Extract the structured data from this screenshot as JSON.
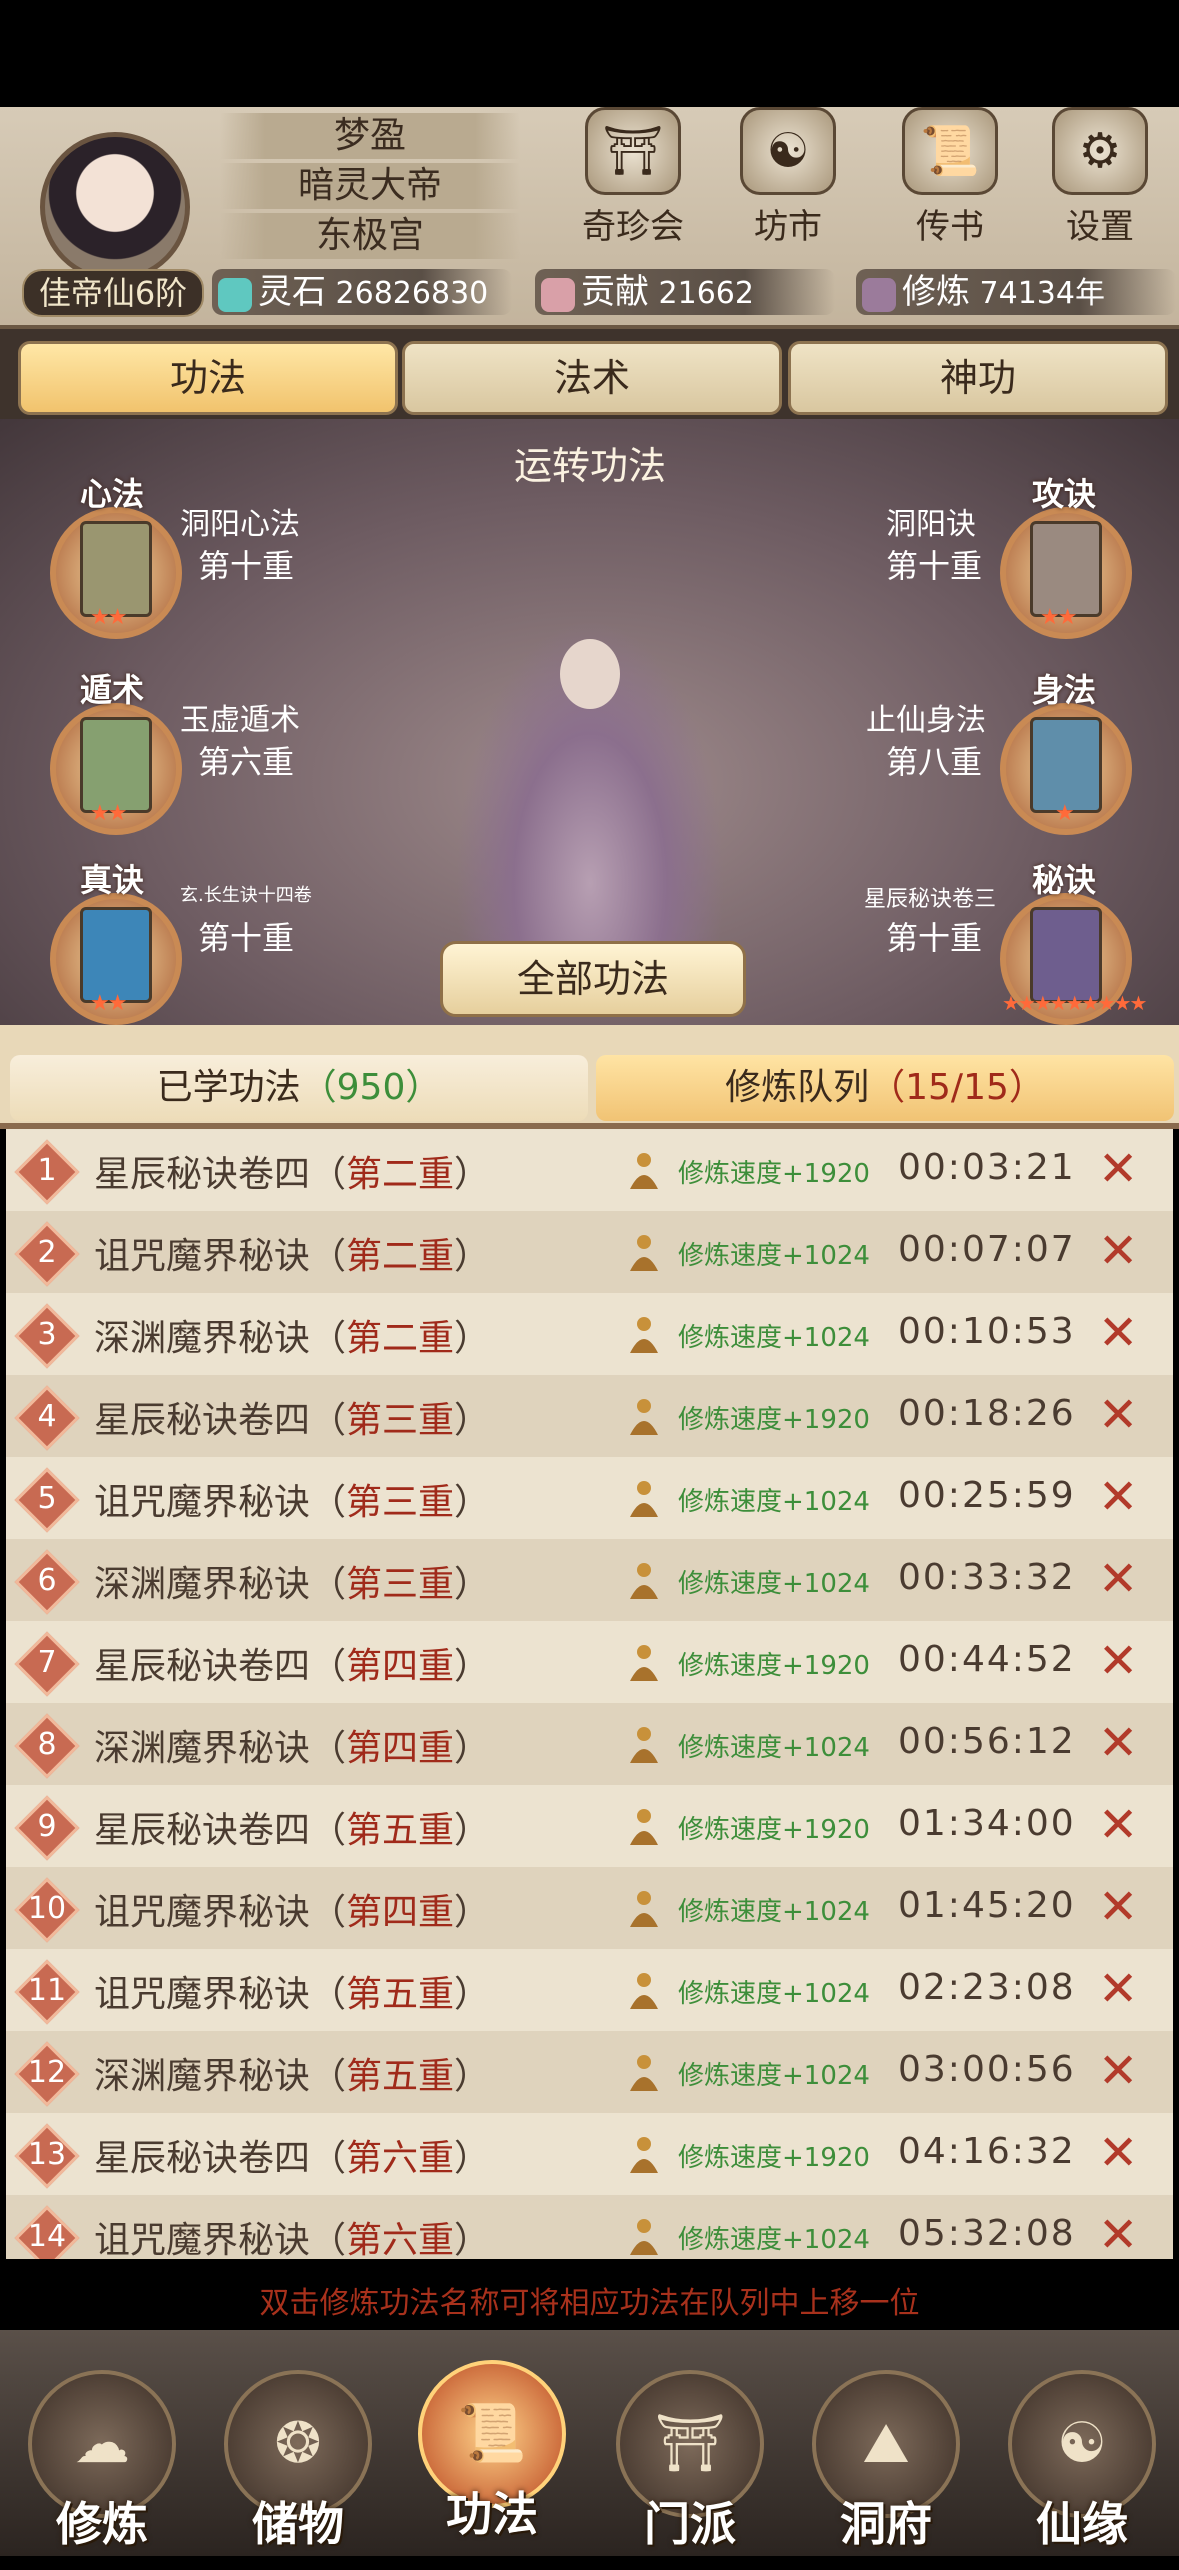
{
  "header": {
    "rank": "佳帝仙6阶",
    "names": [
      "梦盈",
      "暗灵大帝",
      "东极宫"
    ],
    "icons": [
      {
        "label": "奇珍会",
        "icon": "pavilion-icon"
      },
      {
        "label": "坊市",
        "icon": "market-icon"
      },
      {
        "label": "传书",
        "icon": "scroll-icon"
      },
      {
        "label": "设置",
        "icon": "gear-icon"
      }
    ],
    "resources": [
      {
        "label": "灵石",
        "value": "26826830",
        "icon": "spirit-stone-icon",
        "color": "#5fc8c0"
      },
      {
        "label": "贡献",
        "value": "21662",
        "icon": "contribution-icon",
        "color": "#d9a0a8"
      },
      {
        "label": "修炼",
        "value": "74134年",
        "icon": "cultivation-icon",
        "color": "#9b7b9b"
      }
    ]
  },
  "tabs": [
    {
      "label": "功法",
      "active": true
    },
    {
      "label": "法术",
      "active": false
    },
    {
      "label": "神功",
      "active": false
    }
  ],
  "scene": {
    "title": "运转功法",
    "slots": [
      {
        "type": "心法",
        "name": "洞阳心法",
        "level": "第十重",
        "stars": "★★"
      },
      {
        "type": "攻诀",
        "name": "洞阳诀",
        "level": "第十重",
        "stars": "★★"
      },
      {
        "type": "遁术",
        "name": "玉虚遁术",
        "level": "第六重",
        "stars": "★★"
      },
      {
        "type": "身法",
        "name": "止仙身法",
        "level": "第八重",
        "stars": "★"
      },
      {
        "type": "真诀",
        "name": "玄.长生诀十四卷",
        "level": "第十重",
        "stars": "★★"
      },
      {
        "type": "秘诀",
        "name": "星辰秘诀卷三",
        "level": "第十重",
        "stars": "★★★★★★★★★"
      }
    ],
    "all_button": "全部功法"
  },
  "list_tabs": {
    "learned_label": "已学功法",
    "learned_count": "（950）",
    "queue_label": "修炼队列",
    "queue_count": "（15/15）"
  },
  "queue": [
    {
      "num": "1",
      "name": "星辰秘诀卷四",
      "level": "第二重",
      "speed": "修炼速度+1920",
      "time": "00:03:21"
    },
    {
      "num": "2",
      "name": "诅咒魔界秘诀",
      "level": "第二重",
      "speed": "修炼速度+1024",
      "time": "00:07:07"
    },
    {
      "num": "3",
      "name": "深渊魔界秘诀",
      "level": "第二重",
      "speed": "修炼速度+1024",
      "time": "00:10:53"
    },
    {
      "num": "4",
      "name": "星辰秘诀卷四",
      "level": "第三重",
      "speed": "修炼速度+1920",
      "time": "00:18:26"
    },
    {
      "num": "5",
      "name": "诅咒魔界秘诀",
      "level": "第三重",
      "speed": "修炼速度+1024",
      "time": "00:25:59"
    },
    {
      "num": "6",
      "name": "深渊魔界秘诀",
      "level": "第三重",
      "speed": "修炼速度+1024",
      "time": "00:33:32"
    },
    {
      "num": "7",
      "name": "星辰秘诀卷四",
      "level": "第四重",
      "speed": "修炼速度+1920",
      "time": "00:44:52"
    },
    {
      "num": "8",
      "name": "深渊魔界秘诀",
      "level": "第四重",
      "speed": "修炼速度+1024",
      "time": "00:56:12"
    },
    {
      "num": "9",
      "name": "星辰秘诀卷四",
      "level": "第五重",
      "speed": "修炼速度+1920",
      "time": "01:34:00"
    },
    {
      "num": "10",
      "name": "诅咒魔界秘诀",
      "level": "第四重",
      "speed": "修炼速度+1024",
      "time": "01:45:20"
    },
    {
      "num": "11",
      "name": "诅咒魔界秘诀",
      "level": "第五重",
      "speed": "修炼速度+1024",
      "time": "02:23:08"
    },
    {
      "num": "12",
      "name": "深渊魔界秘诀",
      "level": "第五重",
      "speed": "修炼速度+1024",
      "time": "03:00:56"
    },
    {
      "num": "13",
      "name": "星辰秘诀卷四",
      "level": "第六重",
      "speed": "修炼速度+1920",
      "time": "04:16:32"
    },
    {
      "num": "14",
      "name": "诅咒魔界秘诀",
      "level": "第六重",
      "speed": "修炼速度+1024",
      "time": "05:32:08"
    }
  ],
  "hint": "双击修炼功法名称可将相应功法在队列中上移一位",
  "nav": [
    {
      "label": "修炼",
      "icon": "sage-icon",
      "active": false
    },
    {
      "label": "储物",
      "icon": "bag-icon",
      "active": false
    },
    {
      "label": "功法",
      "icon": "scroll-book-icon",
      "active": true
    },
    {
      "label": "门派",
      "icon": "temple-icon",
      "active": false
    },
    {
      "label": "洞府",
      "icon": "cave-icon",
      "active": false
    },
    {
      "label": "仙缘",
      "icon": "yin-yang-icon",
      "active": false
    }
  ]
}
